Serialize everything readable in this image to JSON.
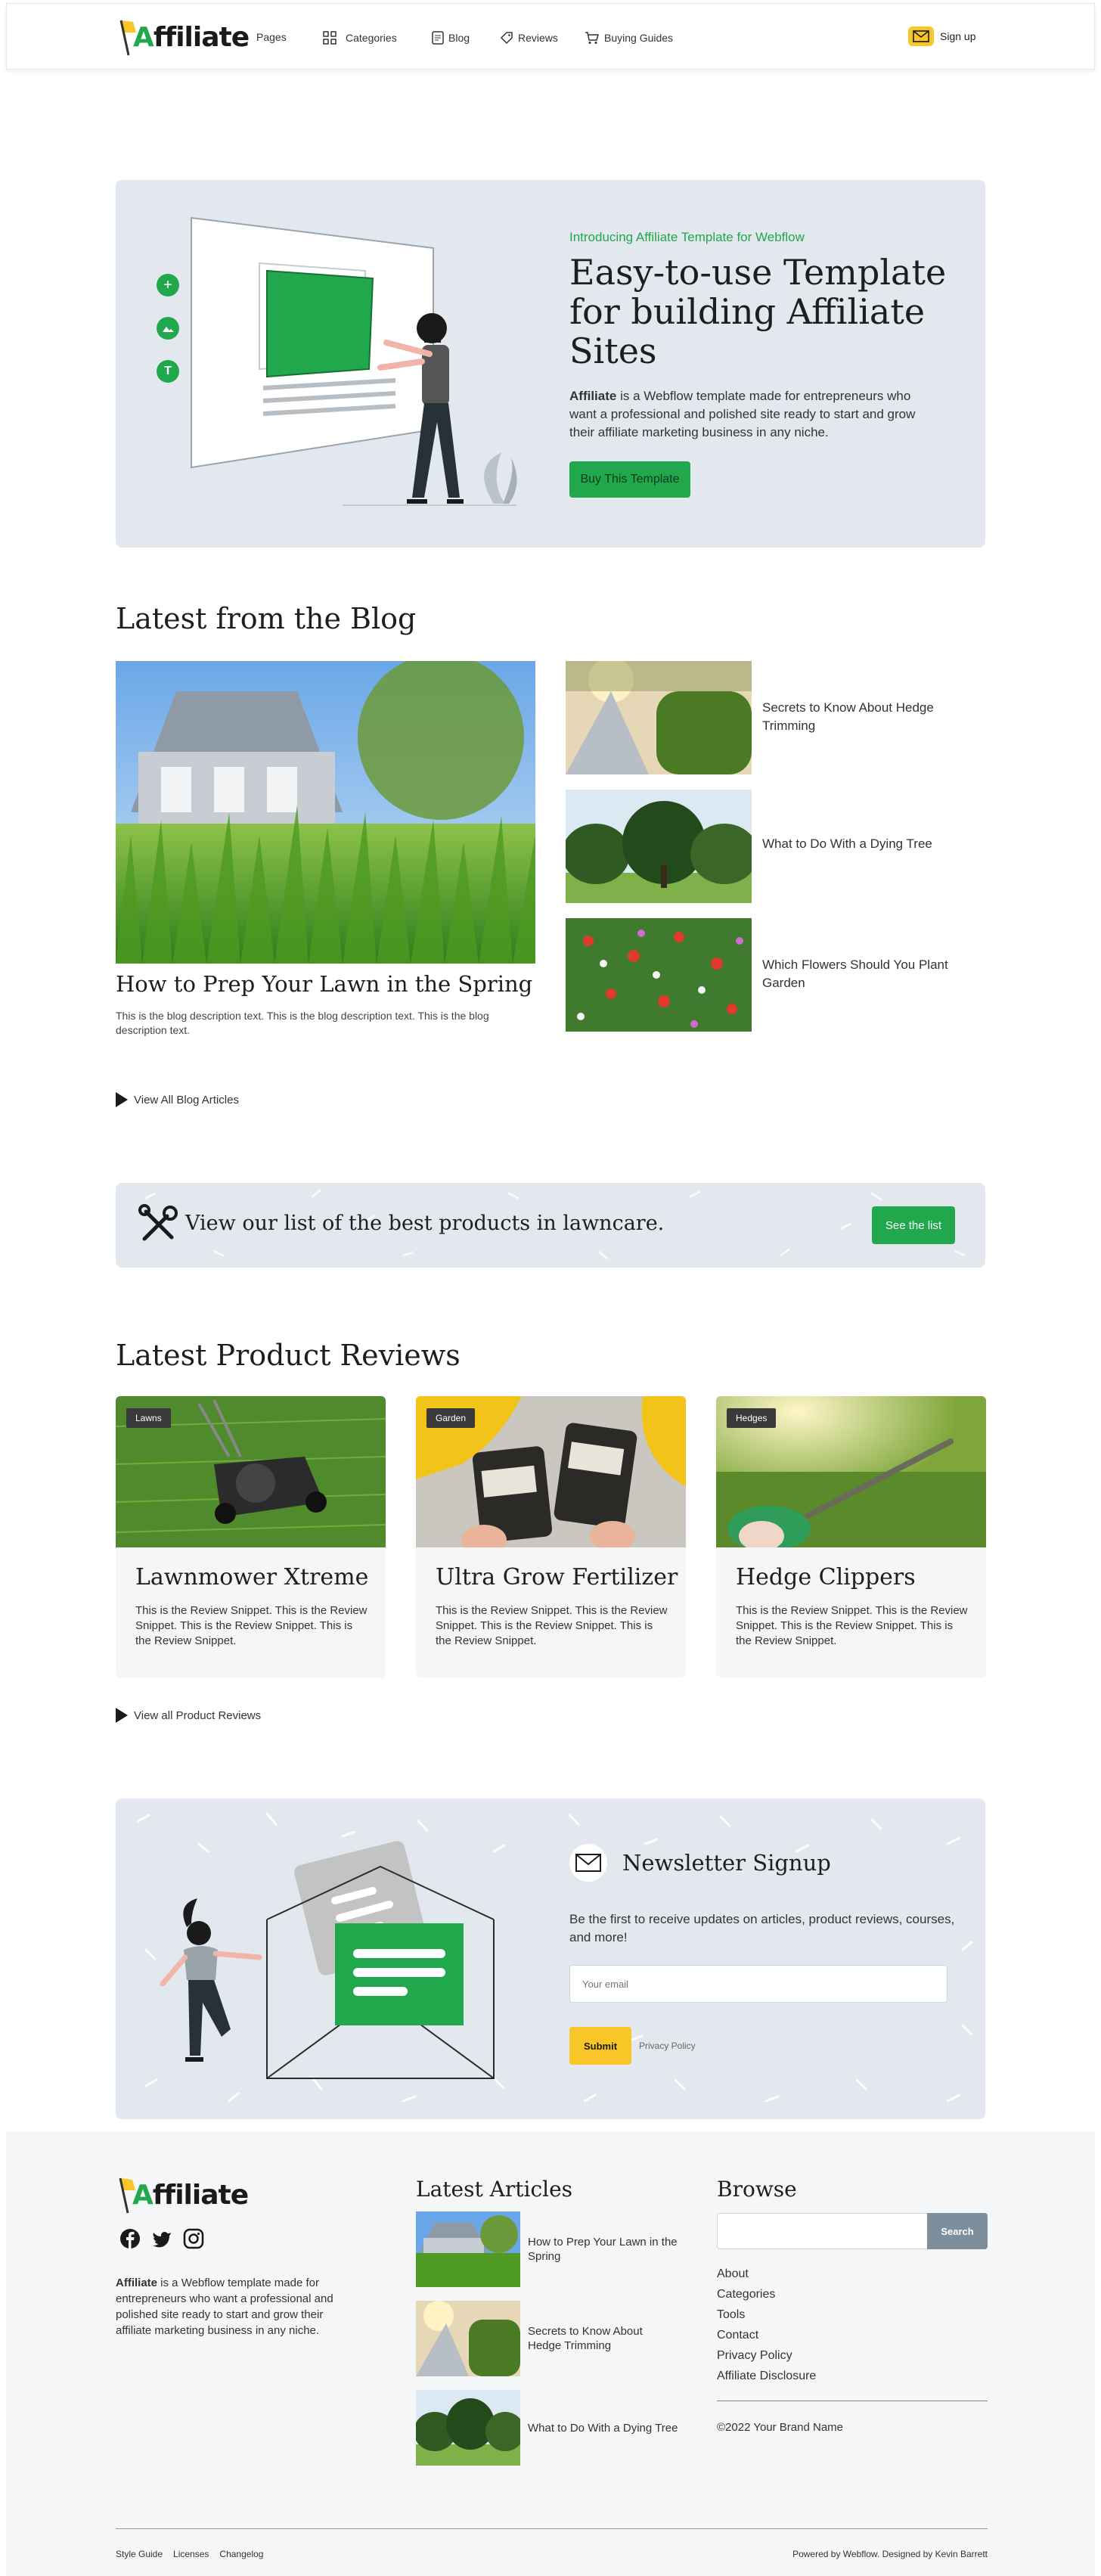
{
  "nav": {
    "logo_text_prefix": "A",
    "logo_text_rest": "ffiliate",
    "items": [
      {
        "label": "Pages",
        "icon": ""
      },
      {
        "label": "Categories",
        "icon": "grid-icon"
      },
      {
        "label": "Blog",
        "icon": "blog-icon"
      },
      {
        "label": "Reviews",
        "icon": "tag-icon"
      },
      {
        "label": "Buying Guides",
        "icon": "cart-icon"
      }
    ],
    "signup_label": "Sign up"
  },
  "hero": {
    "intro": "Introducing Affiliate Template for Webflow",
    "title": "Easy-to-use Template for building Affiliate Sites",
    "desc_strong": "Affiliate",
    "desc_rest": " is a Webflow template made for entrepreneurs who want a professional and polished site ready to start and grow their affiliate marketing business in any niche.",
    "button": "Buy This Template"
  },
  "blog": {
    "heading": "Latest from the Blog",
    "featured_title": "How to Prep Your Lawn in the Spring",
    "featured_desc": "This is the blog description text. This is the blog description text. This is the blog description text.",
    "side_posts": [
      {
        "title": "Secrets to Know About Hedge Trimming"
      },
      {
        "title": "What to Do With a Dying Tree"
      },
      {
        "title": "Which Flowers Should You Plant Garden"
      }
    ],
    "view_all": "View All Blog Articles"
  },
  "banner": {
    "text": "View our list of the best products in lawncare.",
    "button": "See the list"
  },
  "reviews": {
    "heading": "Latest Product Reviews",
    "cards": [
      {
        "tag": "Lawns",
        "title": "Lawnmower Xtreme",
        "snippet": "This is the Review Snippet. This is the Review Snippet. This is the Review Snippet. This is the Review Snippet."
      },
      {
        "tag": "Garden",
        "title": "Ultra Grow Fertilizer",
        "snippet": "This is the Review Snippet. This is the Review Snippet. This is the Review Snippet. This is the Review Snippet."
      },
      {
        "tag": "Hedges",
        "title": "Hedge Clippers",
        "snippet": "This is the Review Snippet. This is the Review Snippet. This is the Review Snippet. This is the Review Snippet."
      }
    ],
    "view_all": "View all Product Reviews"
  },
  "newsletter": {
    "title": "Newsletter Signup",
    "desc": "Be the first to receive updates on articles, product reviews, courses, and more!",
    "email_placeholder": "Your email",
    "submit": "Submit",
    "privacy": "Privacy Policy"
  },
  "footer": {
    "about_strong": "Affiliate",
    "about_rest": " is a Webflow template made for entrepreneurs who want a professional and polished site ready to start and grow their affiliate marketing business in any niche.",
    "articles_heading": "Latest Articles",
    "articles": [
      {
        "title": "How to Prep Your Lawn in the Spring"
      },
      {
        "title": "Secrets to Know About Hedge Trimming"
      },
      {
        "title": "What to Do With a Dying Tree"
      }
    ],
    "browse_heading": "Browse",
    "search_button": "Search",
    "links": [
      "About",
      "Categories",
      "Tools",
      "Contact",
      "Privacy Policy",
      "Affiliate Disclosure"
    ],
    "copyright": "©2022 Your Brand Name",
    "bottom_links": [
      "Style Guide",
      "Licenses",
      "Changelog"
    ],
    "powered_prefix": "Powered by ",
    "powered_webflow": "Webflow",
    "designed": ". Designed by Kevin Barrett"
  },
  "colors": {
    "accent": "#21a84d",
    "yellow": "#f8c627",
    "panel": "#e2e8ee"
  }
}
